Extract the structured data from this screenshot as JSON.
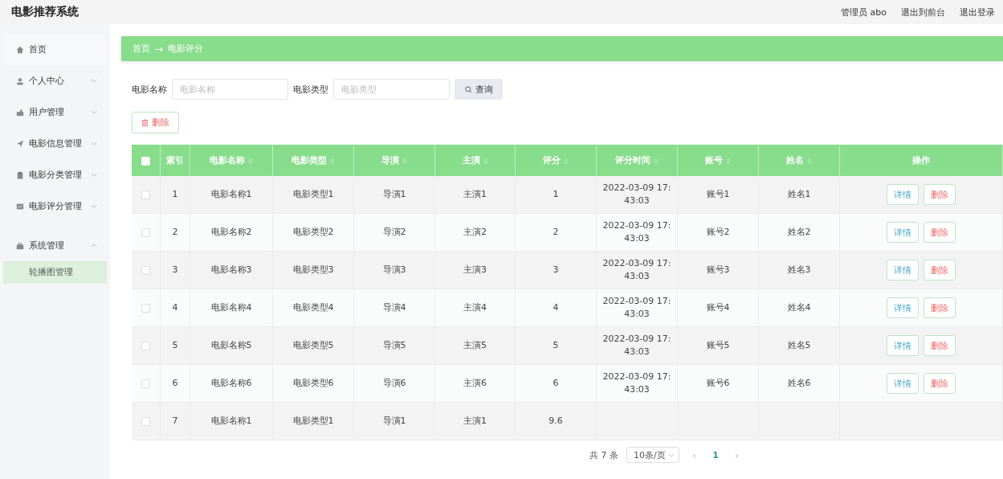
{
  "header": {
    "title": "电影推荐系统",
    "user": "管理员 abo",
    "links": [
      "退出到前台",
      "退出登录"
    ]
  },
  "sidebar": {
    "items": [
      {
        "label": "首页"
      },
      {
        "label": "个人中心",
        "expanded": false
      },
      {
        "label": "用户管理",
        "expanded": false
      },
      {
        "label": "电影信息管理",
        "expanded": false
      },
      {
        "label": "电影分类管理",
        "expanded": false
      },
      {
        "label": "电影评分管理",
        "expanded": false
      },
      {
        "label": "系统管理",
        "expanded": true,
        "children": [
          {
            "label": "轮播图管理",
            "selected": true
          }
        ]
      }
    ]
  },
  "breadcrumb": [
    "首页",
    "→",
    "电影评分"
  ],
  "search": {
    "fields": [
      {
        "label": "电影名称",
        "placeholder": "电影名称"
      },
      {
        "label": "电影类型",
        "placeholder": "电影类型"
      }
    ],
    "button": "查询"
  },
  "delete_button": "删除",
  "table": {
    "all_checked": false,
    "columns": [
      {
        "label": "索引",
        "sortable": false
      },
      {
        "label": "电影名称",
        "sortable": true
      },
      {
        "label": "电影类型",
        "sortable": true
      },
      {
        "label": "导演",
        "sortable": true
      },
      {
        "label": "主演",
        "sortable": true
      },
      {
        "label": "评分",
        "sortable": true
      },
      {
        "label": "评分时间",
        "sortable": true
      },
      {
        "label": "账号",
        "sortable": true
      },
      {
        "label": "姓名",
        "sortable": true
      },
      {
        "label": "操作",
        "sortable": false
      }
    ],
    "rows": [
      {
        "checked": false,
        "cells": [
          "1",
          "电影名称1",
          "电影类型1",
          "导演1",
          "主演1",
          "1",
          "2022-03-09 17:43:03",
          "账号1",
          "姓名1"
        ],
        "actions": [
          "详情",
          "删除"
        ]
      },
      {
        "checked": false,
        "cells": [
          "2",
          "电影名称2",
          "电影类型2",
          "导演2",
          "主演2",
          "2",
          "2022-03-09 17:43:03",
          "账号2",
          "姓名2"
        ],
        "actions": [
          "详情",
          "删除"
        ]
      },
      {
        "checked": false,
        "cells": [
          "3",
          "电影名称3",
          "电影类型3",
          "导演3",
          "主演3",
          "3",
          "2022-03-09 17:43:03",
          "账号3",
          "姓名3"
        ],
        "actions": [
          "详情",
          "删除"
        ]
      },
      {
        "checked": false,
        "cells": [
          "4",
          "电影名称4",
          "电影类型4",
          "导演4",
          "主演4",
          "4",
          "2022-03-09 17:43:03",
          "账号4",
          "姓名4"
        ],
        "actions": [
          "详情",
          "删除"
        ]
      },
      {
        "checked": false,
        "cells": [
          "5",
          "电影名称5",
          "电影类型5",
          "导演5",
          "主演5",
          "5",
          "2022-03-09 17:43:03",
          "账号5",
          "姓名5"
        ],
        "actions": [
          "详情",
          "删除"
        ]
      },
      {
        "checked": false,
        "cells": [
          "6",
          "电影名称6",
          "电影类型6",
          "导演6",
          "主演6",
          "6",
          "2022-03-09 17:43:03",
          "账号6",
          "姓名6"
        ],
        "actions": [
          "详情",
          "删除"
        ]
      },
      {
        "checked": false,
        "cells": [
          "7",
          "电影名称1",
          "电影类型1",
          "导演1",
          "主演1",
          "9.6"
        ],
        "actions": []
      }
    ]
  },
  "pagination": {
    "total": "共 7 条",
    "page_size": "10条/页",
    "prev": "‹",
    "pages": [
      {
        "label": "1",
        "selected": true
      }
    ],
    "next": "›"
  }
}
